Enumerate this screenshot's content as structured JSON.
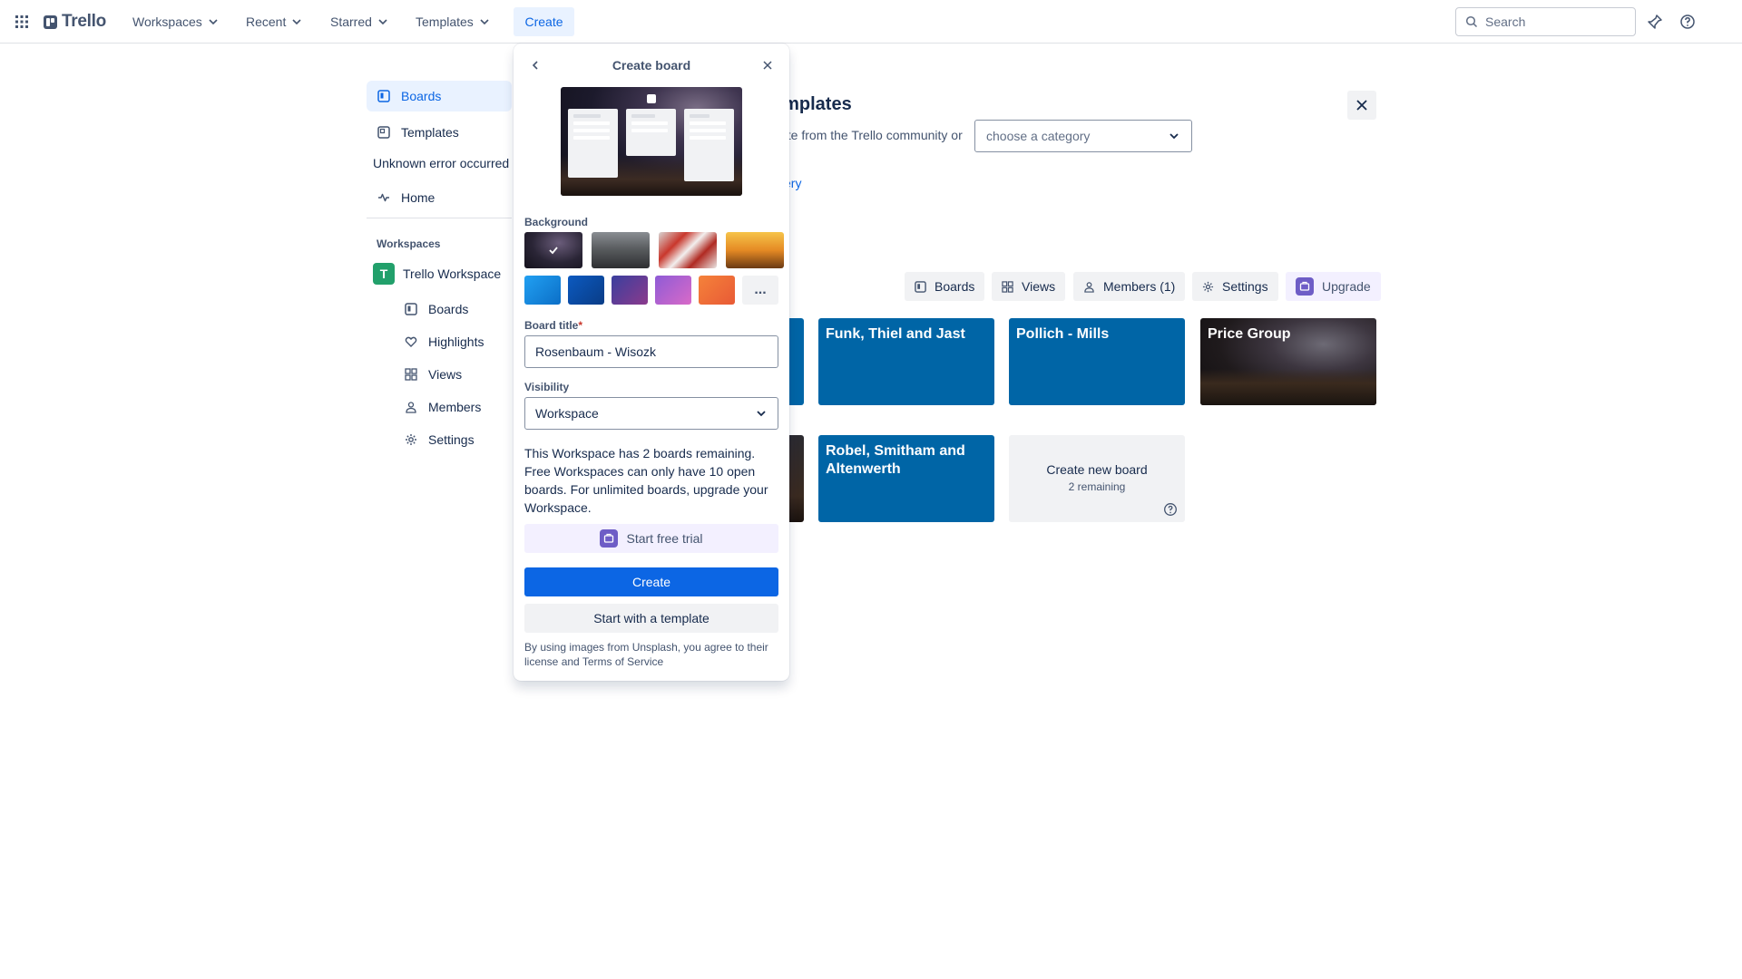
{
  "topbar": {
    "logo": "Trello",
    "menus": [
      "Workspaces",
      "Recent",
      "Starred",
      "Templates"
    ],
    "create_label": "Create",
    "search_placeholder": "Search"
  },
  "sidebar": {
    "items": [
      {
        "label": "Boards",
        "icon": "board-icon",
        "active": true
      },
      {
        "label": "Templates",
        "icon": "template-icon",
        "active": false
      }
    ],
    "error_text": "Unknown error occurred",
    "home_label": "Home",
    "workspaces_heading": "Workspaces",
    "workspace": {
      "initial": "T",
      "name": "Trello Workspace"
    },
    "workspace_items": [
      {
        "label": "Boards",
        "icon": "board-icon"
      },
      {
        "label": "Highlights",
        "icon": "heart-icon"
      },
      {
        "label": "Views",
        "icon": "grid-icon"
      },
      {
        "label": "Members",
        "icon": "members-icon"
      },
      {
        "label": "Settings",
        "icon": "gear-icon"
      }
    ]
  },
  "main": {
    "title_fragment": "emplates",
    "subtitle_fragment": "ate from the Trello community or",
    "category_placeholder": "choose a category",
    "link_fragment": "ery",
    "tabs": [
      {
        "label": "Boards",
        "icon": "board-icon"
      },
      {
        "label": "Views",
        "icon": "grid-icon"
      },
      {
        "label": "Members (1)",
        "icon": "member-icon"
      },
      {
        "label": "Settings",
        "icon": "gear-icon"
      },
      {
        "label": "Upgrade",
        "icon": "upgrade-icon"
      }
    ],
    "boards": [
      {
        "title": "Funk, Thiel and Jast",
        "background": "#0065a6"
      },
      {
        "title": "Pollich - Mills",
        "background": "#0065a6"
      },
      {
        "title": "Price Group",
        "background": "photo-night-sky"
      },
      {
        "title": "Robel, Smitham and Altenwerth",
        "background": "#0065a6"
      }
    ],
    "new_board": {
      "label": "Create new board",
      "remaining": "2 remaining"
    }
  },
  "popover": {
    "title": "Create board",
    "background_label": "Background",
    "photo_backgrounds": [
      "night-sky-mountains",
      "misty-valley",
      "red-white-fabric",
      "sailing-ship-sunset"
    ],
    "color_backgrounds": [
      "#0c8ee6",
      "#0a4fa6",
      "#6a3d9a",
      "#b460d8",
      "#f0733e"
    ],
    "more_label": "...",
    "board_title_label": "Board title",
    "required_mark": "*",
    "board_title_value": "Rosenbaum - Wisozk",
    "visibility_label": "Visibility",
    "visibility_value": "Workspace",
    "info": "This Workspace has 2 boards remaining. Free Workspaces can only have 10 open boards. For unlimited boards, upgrade your Workspace.",
    "trial_label": "Start free trial",
    "create_label": "Create",
    "template_label": "Start with a template",
    "legal": "By using images from Unsplash, you agree to their license and Terms of Service"
  },
  "colors": {
    "accent": "#0c66e4",
    "board_blue": "#0065a6",
    "upgrade_purple": "#6e5dc6",
    "workspace_green": "#22a06b"
  }
}
